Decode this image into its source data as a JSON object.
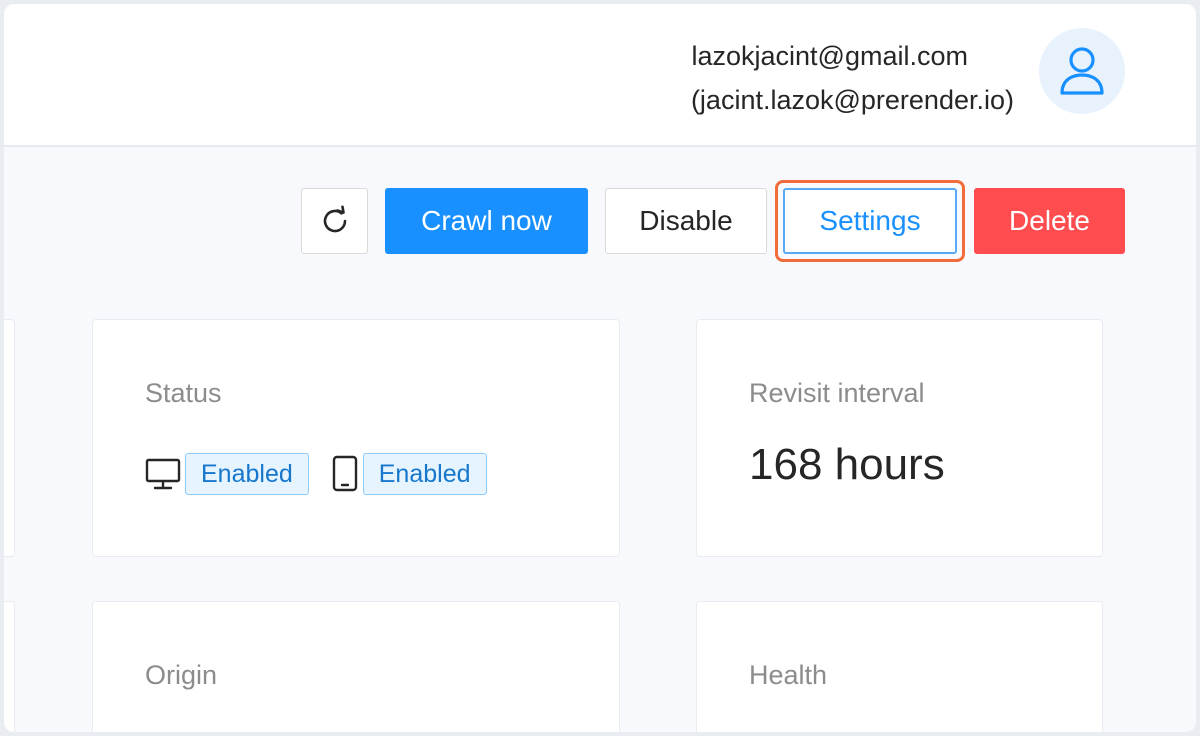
{
  "header": {
    "user_email": "lazokjacint@gmail.com",
    "user_alias": "(jacint.lazok@prerender.io)",
    "avatar_icon": "user-icon"
  },
  "toolbar": {
    "refresh_icon": "refresh-icon",
    "crawl_label": "Crawl now",
    "disable_label": "Disable",
    "settings_label": "Settings",
    "delete_label": "Delete"
  },
  "cards": {
    "status": {
      "label": "Status",
      "desktop_icon": "desktop-icon",
      "desktop_state": "Enabled",
      "mobile_icon": "mobile-icon",
      "mobile_state": "Enabled"
    },
    "revisit": {
      "label": "Revisit interval",
      "value": "168 hours"
    },
    "origin": {
      "label": "Origin"
    },
    "health": {
      "label": "Health"
    }
  },
  "colors": {
    "primary": "#1890ff",
    "danger": "#ff4d4f",
    "highlight": "#f26b3a",
    "tag_bg": "#e6f4ff"
  }
}
